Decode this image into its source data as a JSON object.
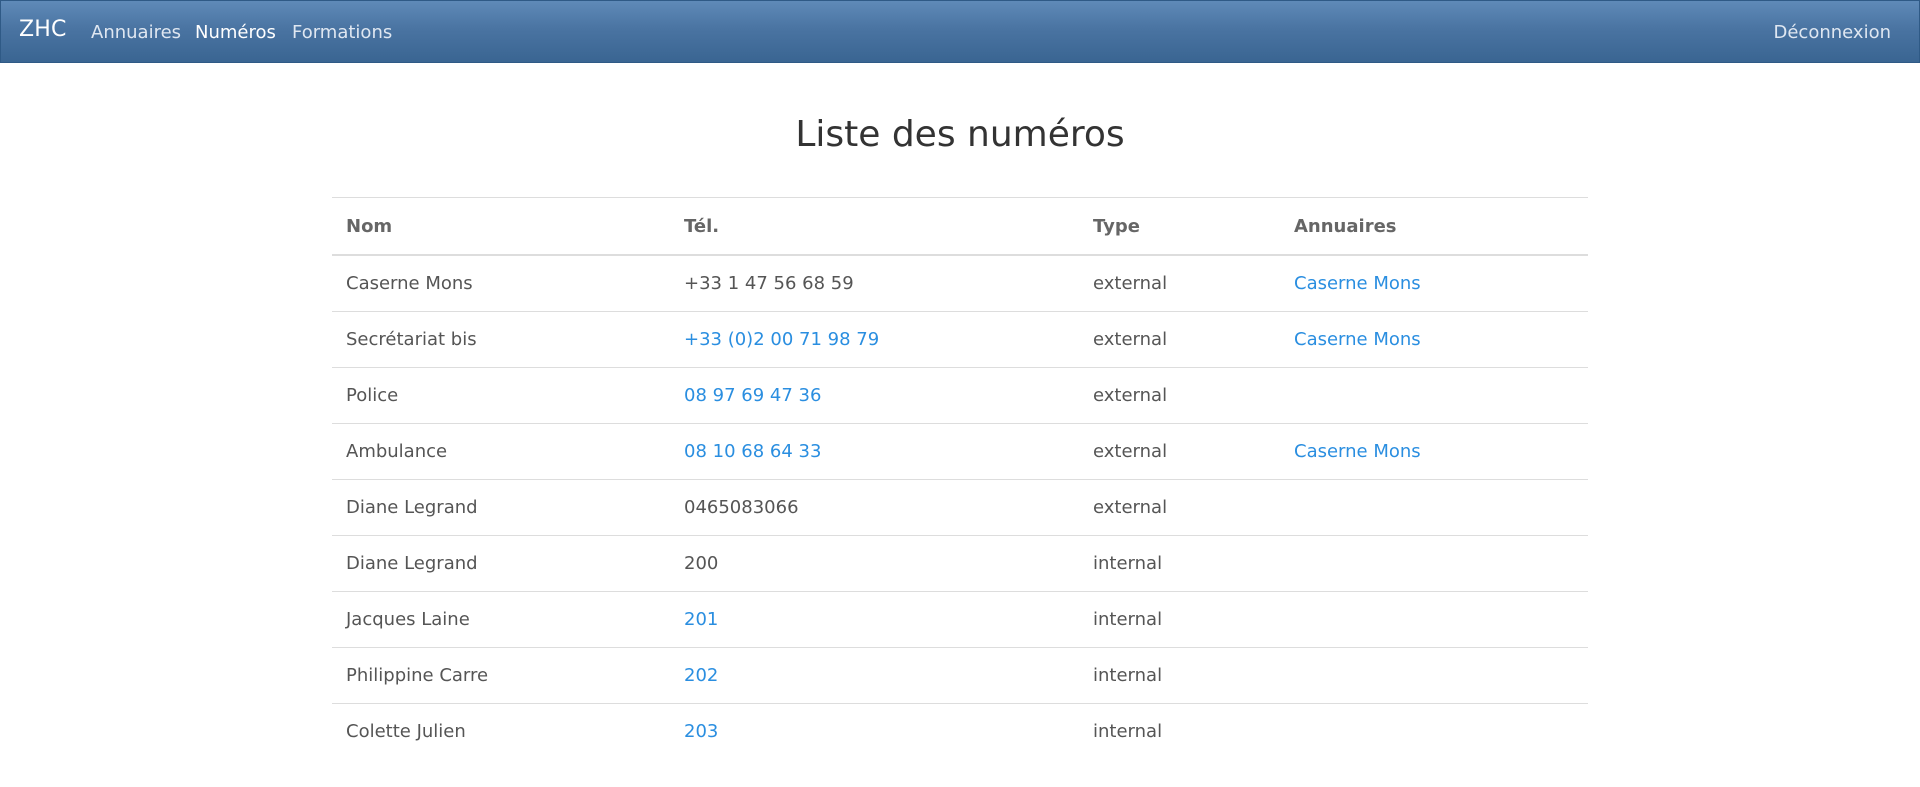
{
  "navbar": {
    "brand": "ZHC",
    "links": [
      {
        "label": "Annuaires",
        "active": false
      },
      {
        "label": "Numéros",
        "active": true
      },
      {
        "label": "Formations",
        "active": false
      }
    ],
    "logout_label": "Déconnexion"
  },
  "page": {
    "title": "Liste des numéros"
  },
  "table": {
    "headers": {
      "nom": "Nom",
      "tel": "Tél.",
      "type": "Type",
      "annuaires": "Annuaires"
    },
    "rows": [
      {
        "nom": "Caserne Mons",
        "tel": "+33 1 47 56 68 59",
        "tel_is_link": false,
        "type": "external",
        "annuaire": "Caserne Mons"
      },
      {
        "nom": "Secrétariat bis",
        "tel": "+33 (0)2 00 71 98 79",
        "tel_is_link": true,
        "type": "external",
        "annuaire": "Caserne Mons"
      },
      {
        "nom": "Police",
        "tel": "08 97 69 47 36",
        "tel_is_link": true,
        "type": "external",
        "annuaire": ""
      },
      {
        "nom": "Ambulance",
        "tel": "08 10 68 64 33",
        "tel_is_link": true,
        "type": "external",
        "annuaire": "Caserne Mons"
      },
      {
        "nom": "Diane Legrand",
        "tel": "0465083066",
        "tel_is_link": false,
        "type": "external",
        "annuaire": ""
      },
      {
        "nom": "Diane Legrand",
        "tel": "200",
        "tel_is_link": false,
        "type": "internal",
        "annuaire": ""
      },
      {
        "nom": "Jacques Laine",
        "tel": "201",
        "tel_is_link": true,
        "type": "internal",
        "annuaire": ""
      },
      {
        "nom": "Philippine Carre",
        "tel": "202",
        "tel_is_link": true,
        "type": "internal",
        "annuaire": ""
      },
      {
        "nom": "Colette Julien",
        "tel": "203",
        "tel_is_link": true,
        "type": "internal",
        "annuaire": ""
      }
    ]
  },
  "colors": {
    "navbar_top": "#5f8ab8",
    "navbar_bottom": "#3a6592",
    "link": "#2a8ee0",
    "text": "#555555"
  }
}
